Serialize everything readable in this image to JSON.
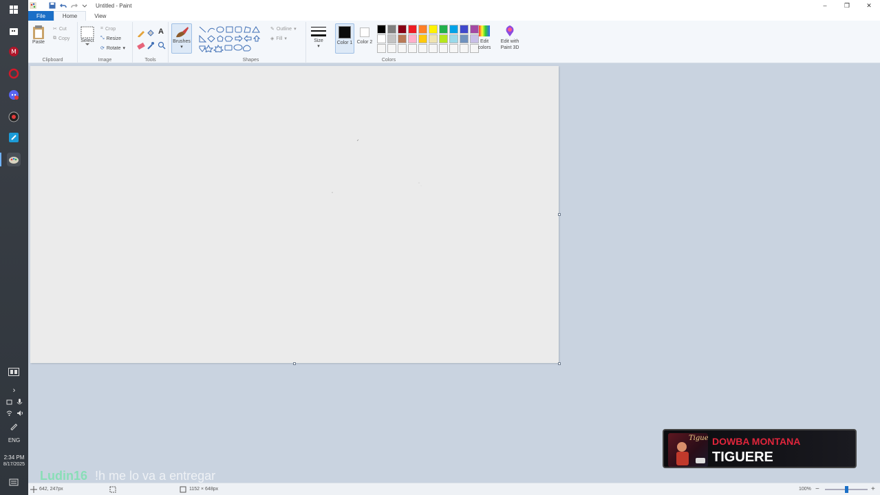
{
  "window": {
    "title": "Untitled - Paint",
    "minimize_glyph": "–",
    "restore_glyph": "❐",
    "close_glyph": "✕"
  },
  "menu": {
    "file": "File",
    "home": "Home",
    "view": "View"
  },
  "ribbon": {
    "clipboard": {
      "label": "Clipboard",
      "paste": "Paste",
      "cut": "Cut",
      "copy": "Copy"
    },
    "image": {
      "label": "Image",
      "select": "Select",
      "crop": "Crop",
      "resize": "Resize",
      "rotate": "Rotate"
    },
    "tools": {
      "label": "Tools",
      "text_glyph": "A"
    },
    "brushes": {
      "label": "Brushes"
    },
    "shapes": {
      "label": "Shapes",
      "outline": "Outline",
      "fill": "Fill"
    },
    "size": {
      "label": "Size"
    },
    "colors": {
      "label": "Colors",
      "color1": "Color 1",
      "color2": "Color 2",
      "edit_colors": "Edit colors",
      "edit_paint3d": "Edit with Paint 3D",
      "color1_value": "#0b0b0b",
      "color2_value": "#ffffff",
      "palette": [
        "#000000",
        "#7f7f7f",
        "#880015",
        "#ed1c24",
        "#ff7f27",
        "#fff200",
        "#22b14c",
        "#00a2e8",
        "#3f48cc",
        "#a349a4",
        "#ffffff",
        "#c3c3c3",
        "#b97a57",
        "#ffaec9",
        "#ffc90e",
        "#efe4b0",
        "#b5e61d",
        "#99d9ea",
        "#7092be",
        "#c8bfe7",
        "#f6f6f6",
        "#f6f6f6",
        "#f6f6f6",
        "#f6f6f6",
        "#f6f6f6",
        "#f6f6f6",
        "#f6f6f6",
        "#f6f6f6",
        "#f6f6f6",
        "#f6f6f6"
      ]
    }
  },
  "status": {
    "cursor_pos": "642, 247px",
    "canvas_size": "1152 × 648px",
    "zoom": "100%",
    "zoom_out": "−",
    "zoom_in": "+"
  },
  "taskbar": {
    "language": "ENG",
    "time": "2:34 PM",
    "date": "8/17/2025",
    "chevron": "›"
  },
  "chat": {
    "user": "Ludin16",
    "message": "!h me lo va a entregar"
  },
  "now_playing": {
    "artist": "DOWBA MONTANA",
    "song": "TIGUERE",
    "art_text": "Tiguere"
  }
}
